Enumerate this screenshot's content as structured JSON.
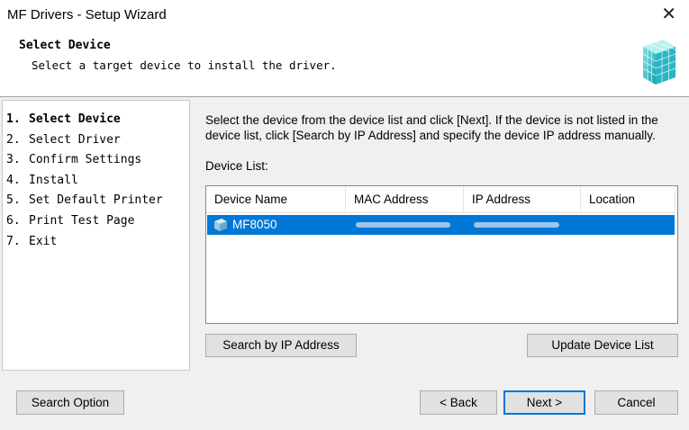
{
  "window": {
    "title": "MF Drivers - Setup Wizard",
    "close_glyph": "✕"
  },
  "header": {
    "title": "Select Device",
    "subtitle": "Select a target device to install the driver.",
    "logo_icon": "cube-grid-logo-icon"
  },
  "steps": [
    {
      "num": "1.",
      "label": "Select Device",
      "active": true
    },
    {
      "num": "2.",
      "label": "Select Driver",
      "active": false
    },
    {
      "num": "3.",
      "label": "Confirm Settings",
      "active": false
    },
    {
      "num": "4.",
      "label": "Install",
      "active": false
    },
    {
      "num": "5.",
      "label": "Set Default Printer",
      "active": false
    },
    {
      "num": "6.",
      "label": "Print Test Page",
      "active": false
    },
    {
      "num": "7.",
      "label": "Exit",
      "active": false
    }
  ],
  "main": {
    "instruction": "Select the device from the device list and click [Next]. If the device is not listed in the device list, click [Search by IP Address] and specify the device IP address manually.",
    "device_list_label": "Device List:",
    "columns": [
      "Device Name",
      "MAC Address",
      "IP Address",
      "Location"
    ],
    "rows": [
      {
        "name": "MF8050",
        "mac": "",
        "ip": "",
        "location": "",
        "selected": true,
        "icon": "printer-device-icon"
      }
    ],
    "search_ip_label": "Search by IP Address",
    "update_list_label": "Update Device List"
  },
  "footer": {
    "search_option_label": "Search Option",
    "back_label": "< Back",
    "next_label": "Next >",
    "cancel_label": "Cancel"
  },
  "colors": {
    "selection": "#0078d7",
    "button_face": "#e1e1e1",
    "dialog_bg": "#f0f0f0"
  }
}
